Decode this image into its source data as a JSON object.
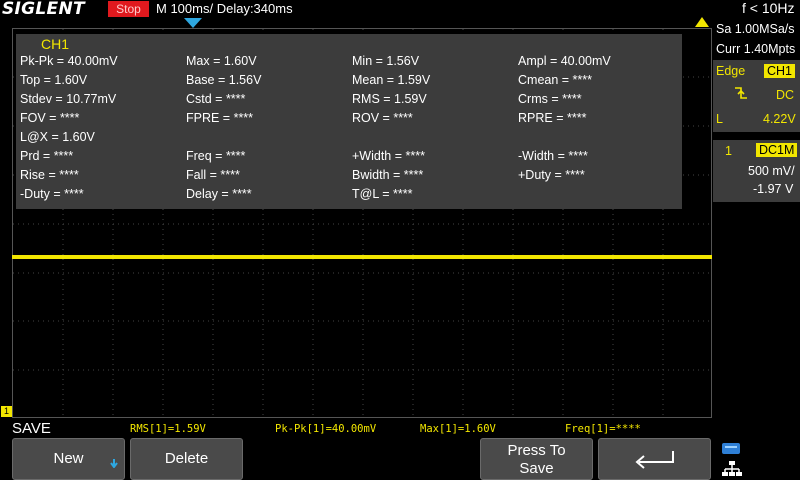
{
  "brand": "SIGLENT",
  "run_state": "Stop",
  "timebase": "M 100ms/",
  "delay": "Delay:340ms",
  "freq_counter": "f < 10Hz",
  "channel": {
    "name": "CH1",
    "color": "#f2e600"
  },
  "measurements": {
    "title": "CH1",
    "rows": [
      [
        "Pk-Pk = 40.00mV",
        "Max = 1.60V",
        "Min = 1.56V",
        "Ampl = 40.00mV"
      ],
      [
        "Top = 1.60V",
        "Base = 1.56V",
        "Mean = 1.59V",
        "Cmean = ****"
      ],
      [
        "Stdev = 10.77mV",
        "Cstd = ****",
        "RMS = 1.59V",
        "Crms = ****"
      ],
      [
        "FOV = ****",
        "FPRE = ****",
        "ROV = ****",
        "RPRE = ****"
      ],
      [
        "L@X = 1.60V",
        "",
        "",
        ""
      ],
      [
        "Prd = ****",
        "Freq = ****",
        "+Width = ****",
        "-Width = ****"
      ],
      [
        "Rise = ****",
        "Fall = ****",
        "Bwidth = ****",
        "+Duty = ****"
      ],
      [
        "-Duty = ****",
        "Delay = ****",
        "T@L = ****",
        ""
      ]
    ]
  },
  "acquisition": {
    "sample_rate": "Sa 1.00MSa/s",
    "memory": "Curr 1.40Mpts"
  },
  "trigger": {
    "type": "Edge",
    "source": "CH1",
    "coupling": "DC",
    "level_label": "L",
    "level": "4.22V"
  },
  "channel_info": {
    "number": "1",
    "coupling": "DC1M",
    "scale": "500 mV/",
    "offset": "-1.97 V"
  },
  "menu_title": "SAVE",
  "readouts": [
    "RMS[1]=1.59V",
    "Pk-Pk[1]=40.00mV",
    "Max[1]=1.60V",
    "Freq[1]=****"
  ],
  "softkeys": {
    "new": "New",
    "delete": "Delete",
    "press_to_save_line1": "Press To",
    "press_to_save_line2": "Save"
  }
}
